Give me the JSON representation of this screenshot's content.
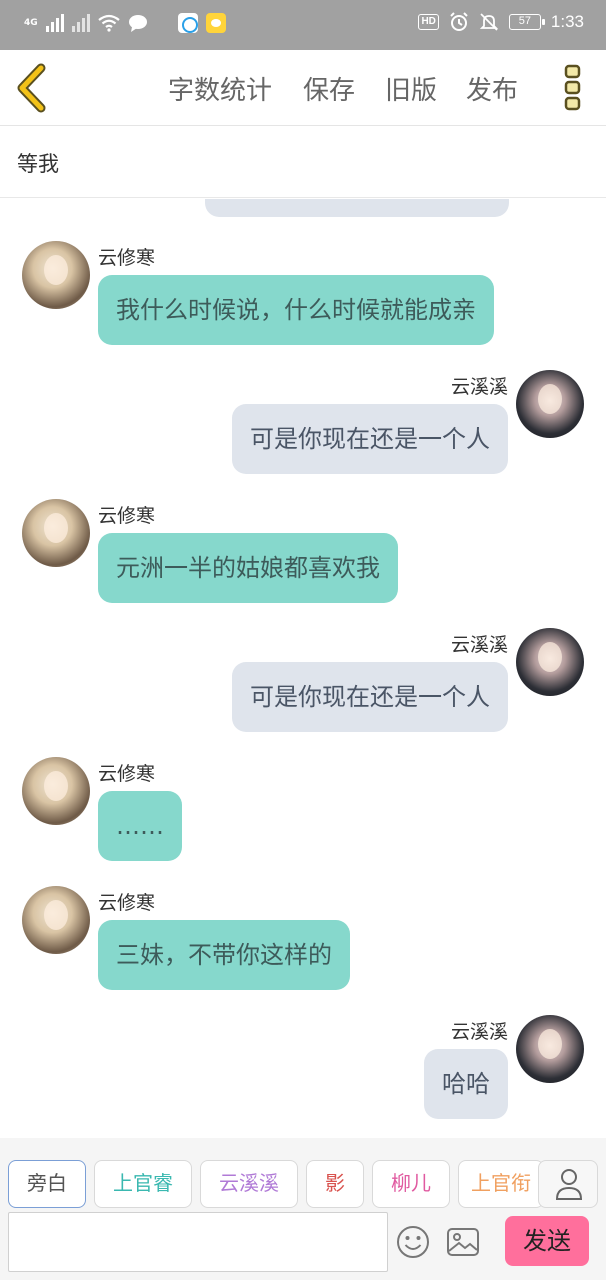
{
  "status_bar": {
    "network": "4G",
    "time": "1:33",
    "hd_label": "HD",
    "battery": "57",
    "icons": [
      "signal-icon",
      "wifi-icon",
      "message-icon",
      "app-icon",
      "app-icon",
      "alarm-icon",
      "mute-icon",
      "battery-icon"
    ]
  },
  "header": {
    "back_icon": "chevron-left-icon",
    "nav": [
      "字数统计",
      "保存",
      "旧版",
      "发布"
    ],
    "more_icon": "more-vertical-icon"
  },
  "title": "等我",
  "messages": [
    {
      "side": "left",
      "name": "云修寒",
      "text": "我什么时候说，什么时候就能成亲"
    },
    {
      "side": "right",
      "name": "云溪溪",
      "text": "可是你现在还是一个人"
    },
    {
      "side": "left",
      "name": "云修寒",
      "text": "元洲一半的姑娘都喜欢我"
    },
    {
      "side": "right",
      "name": "云溪溪",
      "text": "可是你现在还是一个人"
    },
    {
      "side": "left",
      "name": "云修寒",
      "text": "……"
    },
    {
      "side": "left",
      "name": "云修寒",
      "text": "三妹，不带你这样的"
    },
    {
      "side": "right",
      "name": "云溪溪",
      "text": "哈哈"
    }
  ],
  "roles": [
    {
      "label": "旁白",
      "color": "#555555",
      "active": true
    },
    {
      "label": "上官睿",
      "color": "#3ab8b0",
      "active": false
    },
    {
      "label": "云溪溪",
      "color": "#b07ad6",
      "active": false
    },
    {
      "label": "影",
      "color": "#d9534f",
      "active": false
    },
    {
      "label": "柳儿",
      "color": "#e05aa0",
      "active": false
    },
    {
      "label": "上官衔",
      "color": "#f0a060",
      "active": false
    }
  ],
  "input": {
    "placeholder": "",
    "send_label": "发送",
    "emoji_icon": "emoji-icon",
    "image_icon": "image-icon",
    "user_icon": "user-icon"
  },
  "colors": {
    "accent_yellow": "#f3c218",
    "bubble_left": "#86d8cc",
    "bubble_right": "#dfe4ec",
    "send": "#ff6f9c"
  }
}
